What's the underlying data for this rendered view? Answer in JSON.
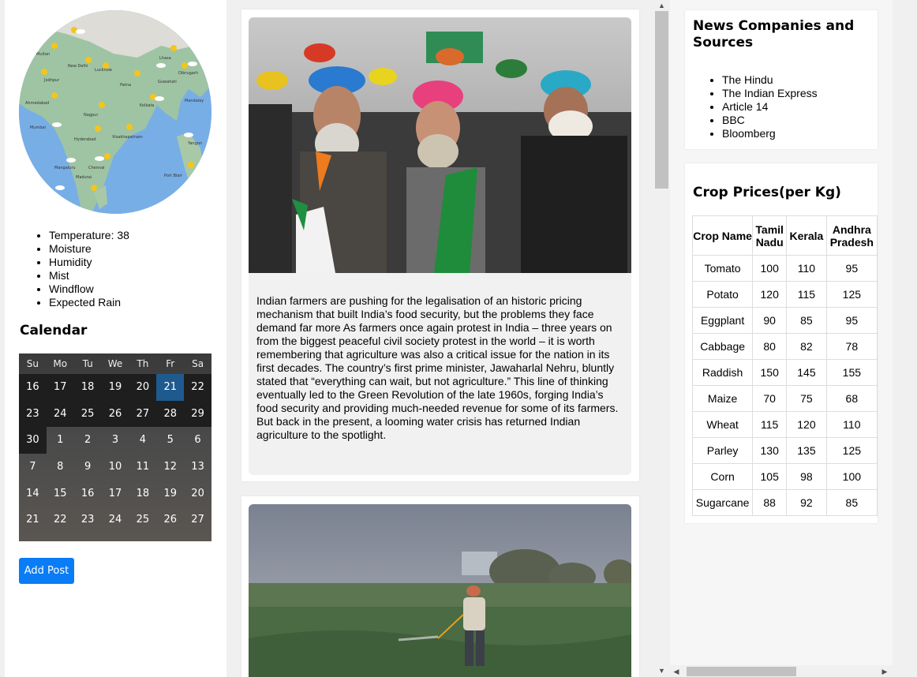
{
  "sidebar": {
    "weather_items": [
      "Temperature: 38",
      "Moisture",
      "Humidity",
      "Mist",
      "Windflow",
      "Expected Rain"
    ],
    "calendar_title": "Calendar",
    "calendar": {
      "weekdays": [
        "Su",
        "Mo",
        "Tu",
        "We",
        "Th",
        "Fr",
        "Sa"
      ],
      "rows": [
        [
          "16",
          "17",
          "18",
          "19",
          "20",
          "21",
          "22"
        ],
        [
          "23",
          "24",
          "25",
          "26",
          "27",
          "28",
          "29"
        ],
        [
          "30",
          "1",
          "2",
          "3",
          "4",
          "5",
          "6"
        ],
        [
          "7",
          "8",
          "9",
          "10",
          "11",
          "12",
          "13"
        ],
        [
          "14",
          "15",
          "16",
          "17",
          "18",
          "19",
          "20"
        ],
        [
          "21",
          "22",
          "23",
          "24",
          "25",
          "26",
          "27"
        ]
      ],
      "selected": "21"
    },
    "add_post_label": "Add Post"
  },
  "feed": {
    "posts": [
      {
        "text": "Indian farmers are pushing for the legalisation of an historic pricing mechanism that built India’s food security, but the problems they face demand far more As farmers once again protest in India – three years on from the biggest peaceful civil society protest in the world – it is worth remembering that agriculture was also a critical issue for the nation in its first decades. The country’s first prime minister, Jawaharlal Nehru, bluntly stated that “everything can wait, but not agriculture.” This line of thinking eventually led to the Green Revolution of the late 1960s, forging India’s food security and providing much-needed revenue for some of its farmers. But back in the present, a looming water crisis has returned Indian agriculture to the spotlight."
      }
    ]
  },
  "news": {
    "title": "News Companies and Sources",
    "sources": [
      "The Hindu",
      "The Indian Express",
      "Article 14",
      "BBC",
      "Bloomberg"
    ]
  },
  "prices": {
    "title": "Crop Prices(per Kg)",
    "headers": [
      "Crop Name",
      "Tamil Nadu",
      "Kerala",
      "Andhra Pradesh"
    ],
    "rows": [
      [
        "Tomato",
        "100",
        "110",
        "95"
      ],
      [
        "Potato",
        "120",
        "115",
        "125"
      ],
      [
        "Eggplant",
        "90",
        "85",
        "95"
      ],
      [
        "Cabbage",
        "80",
        "82",
        "78"
      ],
      [
        "Raddish",
        "150",
        "145",
        "155"
      ],
      [
        "Maize",
        "70",
        "75",
        "68"
      ],
      [
        "Wheat",
        "115",
        "120",
        "110"
      ],
      [
        "Parley",
        "130",
        "135",
        "125"
      ],
      [
        "Corn",
        "105",
        "98",
        "100"
      ],
      [
        "Sugarcane",
        "88",
        "92",
        "85"
      ]
    ]
  },
  "map_labels": [
    "Multan",
    "New Delhi",
    "Lhasa",
    "Lucknow",
    "Jodhpur",
    "Patna",
    "Guwahati",
    "Dibrugarh",
    "Ahmedabad",
    "Kolkata",
    "Mandalay",
    "Nagpur",
    "Mumbai",
    "Hyderabad",
    "Visakhapatnam",
    "Yangon",
    "Mangaluru",
    "Chennai",
    "Port Blair",
    "Madurai"
  ],
  "colors": {
    "accent": "#0a7cf5",
    "calendar_selected": "#1f5a8f"
  }
}
